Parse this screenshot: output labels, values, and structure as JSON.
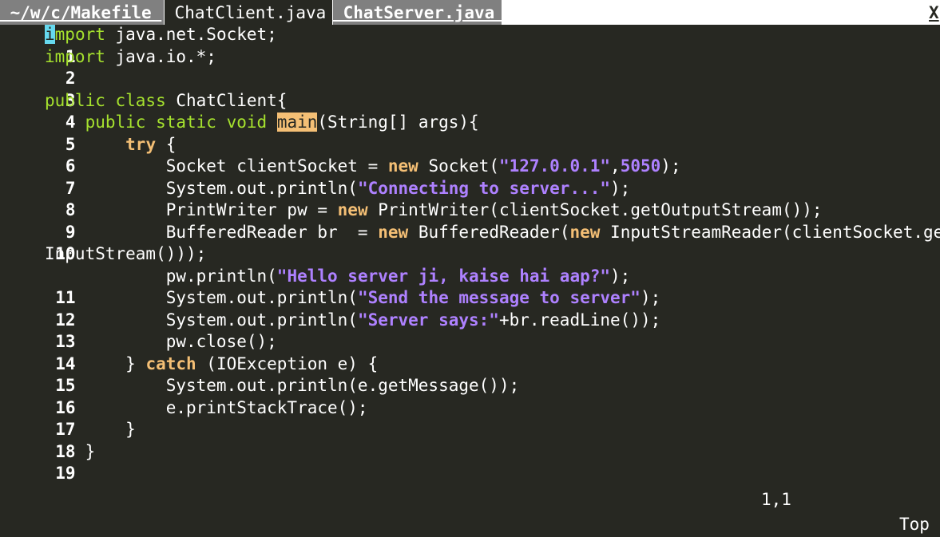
{
  "tabs": [
    {
      "label": " ~/w/c/Makefile ",
      "state": "inactive"
    },
    {
      "label": " ChatClient.java ",
      "state": "active"
    },
    {
      "label": " ChatServer.java ",
      "state": "inactive"
    }
  ],
  "close_label": "X",
  "editor": {
    "line_numbers": [
      "1",
      "2",
      "3",
      "4",
      "5",
      "6",
      "7",
      "8",
      "9",
      "10",
      "",
      "11",
      "12",
      "13",
      "14",
      "15",
      "16",
      "17",
      "18",
      "19"
    ]
  },
  "status": {
    "cursor_position": "1,1",
    "scroll_position": "Top"
  },
  "colors": {
    "background": "#272822",
    "keyword": "#a6e22e",
    "control_keyword": "#f4bf75",
    "string": "#ae81ff",
    "cursor": "#66d9ef",
    "match_highlight": "#f4bf75"
  }
}
